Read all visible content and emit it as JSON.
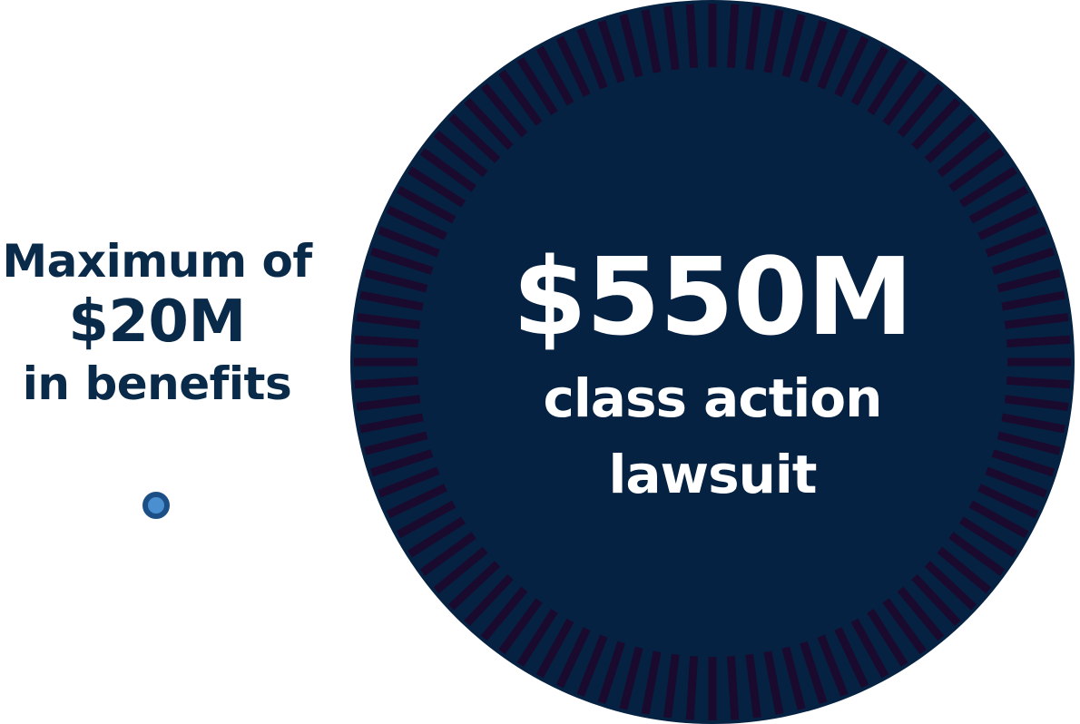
{
  "left_stat": {
    "line1": "Maximum of",
    "line2": "$20M",
    "line3": "in benefits"
  },
  "circle_stat": {
    "amount": "$550M",
    "line1": "class action",
    "line2": "lawsuit"
  },
  "colors": {
    "navy": "#0a2a4a",
    "circle_fill": "#062242",
    "stripe": "#1a0a2e",
    "dot_fill": "#4a90d0",
    "dot_ring": "#1c4f86"
  },
  "icons": {
    "dot": "bullet-dot-icon"
  }
}
